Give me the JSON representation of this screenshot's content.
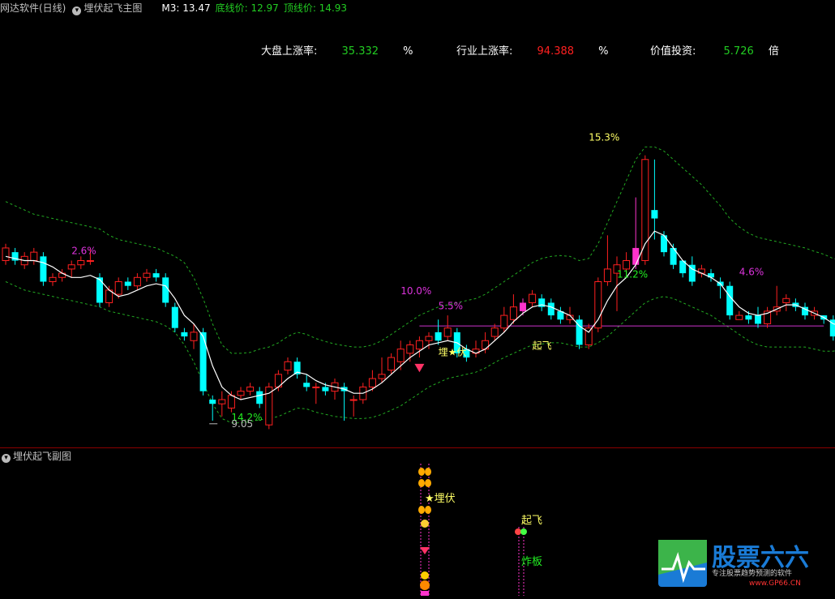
{
  "header": {
    "app_name": "网达软件(日线)",
    "indicator_name": "埋伏起飞主图",
    "m3_label": "M3: 13.47",
    "bottom_price": "底线价: 12.97",
    "top_price": "顶线价: 14.93"
  },
  "stats": {
    "market_label": "大盘上涨率:",
    "market_value": "35.332",
    "market_unit": "%",
    "industry_label": "行业上涨率:",
    "industry_value": "94.388",
    "industry_unit": "%",
    "value_label": "价值投资:",
    "value_value": "5.726",
    "value_unit": "倍"
  },
  "sub_panel": {
    "title": "埋伏起飞副图",
    "ambush_label": "★埋伏",
    "takeoff_label": "起飞",
    "burst_label": "炸板"
  },
  "logo": {
    "main_text": "股票六六",
    "sub_text": "专注股票趋势预测的软件",
    "url": "www.GP66.CN"
  },
  "chart_data": {
    "type": "candlestick",
    "ylim": [
      8.6,
      16.2
    ],
    "x": [
      1,
      2,
      3,
      4,
      5,
      6,
      7,
      8,
      9,
      10,
      11,
      12,
      13,
      14,
      15,
      16,
      17,
      18,
      19,
      20,
      21,
      22,
      23,
      24,
      25,
      26,
      27,
      28,
      29,
      30,
      31,
      32,
      33,
      34,
      35,
      36,
      37,
      38,
      39,
      40,
      41,
      42,
      43,
      44,
      45,
      46,
      47,
      48,
      49,
      50,
      51,
      52,
      53,
      54,
      55,
      56,
      57,
      58,
      59,
      60,
      61,
      62,
      63,
      64,
      65,
      66,
      67,
      68,
      69,
      70,
      71,
      72,
      73,
      74,
      75,
      76,
      77,
      78,
      79,
      80,
      81,
      82,
      83,
      84,
      85,
      86,
      87,
      88
    ],
    "candles": [
      [
        12.9,
        13.2,
        13.3,
        12.8
      ],
      [
        13.1,
        12.9,
        13.2,
        12.8
      ],
      [
        12.8,
        13.0,
        13.1,
        12.7
      ],
      [
        12.9,
        13.1,
        13.2,
        12.8
      ],
      [
        13.0,
        12.4,
        13.1,
        12.3
      ],
      [
        12.4,
        12.5,
        12.6,
        12.3
      ],
      [
        12.5,
        12.6,
        12.7,
        12.4
      ],
      [
        12.7,
        12.8,
        12.9,
        12.5
      ],
      [
        12.8,
        12.9,
        13.0,
        12.7
      ],
      [
        12.9,
        12.9,
        13.2,
        12.8
      ],
      [
        12.5,
        11.9,
        12.6,
        11.8
      ],
      [
        11.9,
        12.2,
        12.3,
        11.8
      ],
      [
        12.1,
        12.4,
        12.5,
        12.0
      ],
      [
        12.4,
        12.3,
        12.5,
        12.2
      ],
      [
        12.3,
        12.5,
        12.6,
        12.2
      ],
      [
        12.5,
        12.6,
        12.7,
        12.4
      ],
      [
        12.6,
        12.5,
        12.7,
        12.4
      ],
      [
        12.5,
        11.9,
        12.6,
        11.8
      ],
      [
        11.8,
        11.3,
        11.9,
        11.2
      ],
      [
        11.2,
        11.1,
        11.3,
        11.0
      ],
      [
        11.0,
        11.2,
        11.4,
        10.8
      ],
      [
        11.2,
        9.8,
        11.3,
        9.7
      ],
      [
        9.6,
        9.5,
        9.7,
        9.1
      ],
      [
        9.5,
        9.6,
        9.8,
        9.2
      ],
      [
        9.4,
        9.7,
        9.8,
        9.3
      ],
      [
        9.7,
        9.8,
        9.9,
        9.6
      ],
      [
        9.8,
        9.9,
        10.0,
        9.7
      ],
      [
        9.8,
        9.5,
        9.9,
        9.4
      ],
      [
        9.0,
        9.9,
        10.0,
        8.9
      ],
      [
        9.9,
        10.2,
        10.3,
        9.8
      ],
      [
        10.3,
        10.5,
        10.6,
        10.2
      ],
      [
        10.5,
        10.2,
        10.6,
        10.1
      ],
      [
        10.0,
        9.9,
        10.2,
        9.8
      ],
      [
        9.9,
        9.9,
        10.0,
        9.5
      ],
      [
        9.9,
        9.8,
        10.0,
        9.7
      ],
      [
        9.8,
        10.0,
        10.1,
        9.6
      ],
      [
        9.9,
        9.8,
        10.0,
        9.1
      ],
      [
        9.6,
        9.6,
        9.7,
        9.2
      ],
      [
        9.6,
        9.9,
        10.0,
        9.5
      ],
      [
        9.9,
        10.1,
        10.3,
        9.8
      ],
      [
        10.1,
        10.2,
        10.6,
        10.0
      ],
      [
        10.3,
        10.6,
        10.7,
        10.2
      ],
      [
        10.5,
        10.8,
        11.0,
        10.3
      ],
      [
        10.7,
        10.9,
        11.0,
        10.5
      ],
      [
        10.8,
        11.0,
        11.1,
        10.6
      ],
      [
        11.0,
        11.1,
        11.2,
        10.8
      ],
      [
        11.2,
        11.0,
        11.5,
        10.9
      ],
      [
        11.1,
        11.3,
        11.6,
        11.0
      ],
      [
        11.2,
        10.7,
        11.3,
        10.6
      ],
      [
        10.8,
        10.6,
        10.9,
        10.5
      ],
      [
        10.7,
        10.8,
        11.0,
        10.6
      ],
      [
        10.8,
        11.0,
        11.2,
        10.7
      ],
      [
        11.1,
        11.3,
        11.4,
        11.0
      ],
      [
        11.3,
        11.6,
        11.8,
        11.2
      ],
      [
        11.5,
        11.8,
        12.1,
        11.4
      ],
      [
        11.7,
        11.9,
        12.0,
        11.6
      ],
      [
        11.9,
        12.1,
        12.2,
        11.8
      ],
      [
        12.0,
        11.8,
        12.1,
        11.7
      ],
      [
        11.9,
        11.6,
        12.0,
        11.5
      ],
      [
        11.7,
        11.5,
        11.8,
        11.4
      ],
      [
        11.5,
        11.6,
        11.8,
        11.4
      ],
      [
        11.5,
        10.9,
        11.6,
        10.8
      ],
      [
        10.9,
        11.3,
        11.4,
        10.8
      ],
      [
        11.3,
        12.4,
        12.5,
        11.2
      ],
      [
        12.4,
        12.7,
        13.5,
        12.3
      ],
      [
        12.6,
        12.8,
        13.0,
        11.7
      ],
      [
        12.7,
        12.9,
        13.1,
        12.6
      ],
      [
        12.8,
        13.2,
        14.4,
        12.7
      ],
      [
        12.9,
        15.3,
        15.4,
        12.8
      ],
      [
        14.1,
        13.9,
        15.3,
        13.4
      ],
      [
        13.5,
        13.1,
        13.6,
        13.0
      ],
      [
        13.2,
        12.8,
        13.3,
        12.7
      ],
      [
        12.9,
        12.6,
        12.9,
        12.5
      ],
      [
        12.8,
        12.4,
        13.0,
        12.3
      ],
      [
        12.6,
        12.7,
        12.8,
        12.5
      ],
      [
        12.6,
        12.5,
        12.7,
        12.4
      ],
      [
        12.4,
        12.3,
        12.5,
        12.0
      ],
      [
        12.3,
        11.6,
        12.4,
        11.5
      ],
      [
        11.5,
        11.6,
        11.7,
        11.5
      ],
      [
        11.6,
        11.5,
        11.7,
        11.4
      ],
      [
        11.6,
        11.4,
        11.8,
        11.3
      ],
      [
        11.4,
        11.7,
        11.8,
        11.3
      ],
      [
        11.7,
        11.8,
        12.3,
        11.6
      ],
      [
        11.9,
        12.0,
        12.1,
        11.7
      ],
      [
        11.9,
        11.8,
        12.0,
        11.7
      ],
      [
        11.8,
        11.6,
        11.9,
        11.5
      ],
      [
        11.6,
        11.7,
        11.8,
        11.5
      ],
      [
        11.6,
        11.5,
        11.6,
        11.4
      ],
      [
        11.5,
        11.1,
        11.6,
        11.0
      ],
      [
        11.4,
        11.6,
        11.7,
        11.3
      ],
      [
        11.6,
        11.8,
        12.0,
        11.5
      ],
      [
        11.8,
        12.1,
        12.2,
        11.7
      ],
      [
        12.0,
        12.2,
        12.3,
        11.9
      ],
      [
        12.1,
        12.3,
        12.4,
        11.6
      ]
    ],
    "ma_line": [
      13.0,
      12.95,
      12.9,
      12.9,
      12.85,
      12.75,
      12.6,
      12.5,
      12.5,
      12.55,
      12.45,
      12.2,
      12.05,
      12.1,
      12.2,
      12.3,
      12.35,
      12.3,
      12.0,
      11.6,
      11.4,
      11.1,
      10.4,
      9.9,
      9.7,
      9.6,
      9.65,
      9.7,
      9.75,
      9.9,
      10.1,
      10.25,
      10.2,
      10.05,
      9.95,
      9.9,
      9.85,
      9.75,
      9.75,
      9.85,
      10.0,
      10.2,
      10.4,
      10.6,
      10.75,
      10.9,
      10.95,
      11.0,
      10.95,
      10.8,
      10.7,
      10.8,
      11.0,
      11.2,
      11.45,
      11.65,
      11.8,
      11.85,
      11.8,
      11.7,
      11.6,
      11.35,
      11.2,
      11.5,
      11.95,
      12.3,
      12.5,
      12.8,
      13.3,
      13.6,
      13.5,
      13.2,
      12.9,
      12.7,
      12.6,
      12.5,
      12.35,
      12.05,
      11.8,
      11.65,
      11.6,
      11.65,
      11.75,
      11.85,
      11.85,
      11.75,
      11.65,
      11.55,
      11.4,
      11.35,
      11.5,
      11.75,
      12.0,
      12.15,
      12.2
    ],
    "upper_band": [
      14.3,
      14.2,
      14.1,
      14.0,
      13.95,
      13.9,
      13.85,
      13.8,
      13.75,
      13.7,
      13.65,
      13.5,
      13.4,
      13.35,
      13.3,
      13.25,
      13.2,
      13.1,
      13.0,
      12.85,
      12.5,
      12.0,
      11.4,
      10.9,
      10.7,
      10.7,
      10.72,
      10.8,
      10.85,
      10.95,
      11.1,
      11.2,
      11.15,
      11.05,
      10.98,
      10.92,
      10.88,
      10.85,
      10.85,
      10.9,
      11.0,
      11.15,
      11.3,
      11.45,
      11.6,
      11.7,
      11.8,
      11.85,
      11.9,
      11.95,
      12.0,
      12.1,
      12.25,
      12.4,
      12.55,
      12.7,
      12.85,
      12.95,
      13.0,
      13.02,
      13.0,
      12.9,
      12.95,
      13.3,
      13.8,
      14.3,
      14.8,
      15.3,
      15.6,
      15.6,
      15.5,
      15.3,
      15.1,
      14.9,
      14.7,
      14.45,
      14.2,
      13.9,
      13.7,
      13.55,
      13.45,
      13.4,
      13.35,
      13.3,
      13.25,
      13.2,
      13.12,
      13.05,
      12.95,
      12.9,
      12.95,
      13.1,
      13.25,
      13.4,
      13.45
    ],
    "lower_band": [
      12.4,
      12.3,
      12.2,
      12.15,
      12.1,
      12.05,
      12.0,
      11.95,
      11.9,
      11.85,
      11.8,
      11.7,
      11.65,
      11.6,
      11.55,
      11.5,
      11.45,
      11.35,
      11.2,
      10.9,
      10.5,
      10.0,
      9.5,
      9.15,
      9.05,
      9.05,
      9.08,
      9.12,
      9.15,
      9.2,
      9.3,
      9.4,
      9.38,
      9.3,
      9.25,
      9.2,
      9.18,
      9.15,
      9.15,
      9.18,
      9.25,
      9.35,
      9.45,
      9.6,
      9.75,
      9.9,
      10.0,
      10.1,
      10.15,
      10.2,
      10.25,
      10.35,
      10.48,
      10.6,
      10.7,
      10.8,
      10.9,
      10.92,
      10.95,
      10.95,
      10.9,
      10.85,
      10.85,
      10.95,
      11.1,
      11.3,
      11.5,
      11.7,
      11.9,
      12.0,
      12.05,
      12.0,
      11.9,
      11.8,
      11.7,
      11.6,
      11.45,
      11.3,
      11.15,
      11.0,
      10.9,
      10.85,
      10.85,
      10.85,
      10.85,
      10.85,
      10.8,
      10.75,
      10.75,
      10.8,
      10.9,
      11.05,
      11.2,
      11.35,
      11.45
    ],
    "support_line": {
      "value": 11.35,
      "from_x": 45,
      "to_x": 88
    },
    "annotations": [
      {
        "text": "2.6%",
        "x": 8,
        "y": 13.05,
        "color": "#dd33dd"
      },
      {
        "text": "14.2%",
        "x": 25,
        "y": 9.1,
        "color": "#22ee22"
      },
      {
        "text": "9.05",
        "x": 25,
        "y": 8.95,
        "color": "#bbbbbb"
      },
      {
        "text": "10.0%",
        "x": 43,
        "y": 12.1,
        "color": "#dd33dd"
      },
      {
        "text": "5.5%",
        "x": 47,
        "y": 11.75,
        "color": "#dd33dd"
      },
      {
        "text": "埋★伏",
        "x": 47,
        "y": 10.65,
        "color": "#ffff66"
      },
      {
        "text": "起飞",
        "x": 57,
        "y": 10.8,
        "color": "#ffff66"
      },
      {
        "text": "15.3%",
        "x": 63,
        "y": 15.75,
        "color": "#ffff66"
      },
      {
        "text": "11.2%",
        "x": 66,
        "y": 12.5,
        "color": "#22ee22"
      },
      {
        "text": "4.6%",
        "x": 79,
        "y": 12.55,
        "color": "#dd33dd"
      }
    ],
    "colors": {
      "up": "#ff2020",
      "down": "#00ffff",
      "signal": "#ff33cc",
      "ma": "#ffffff",
      "band": "#22aa22",
      "support": "#cc33cc"
    }
  }
}
